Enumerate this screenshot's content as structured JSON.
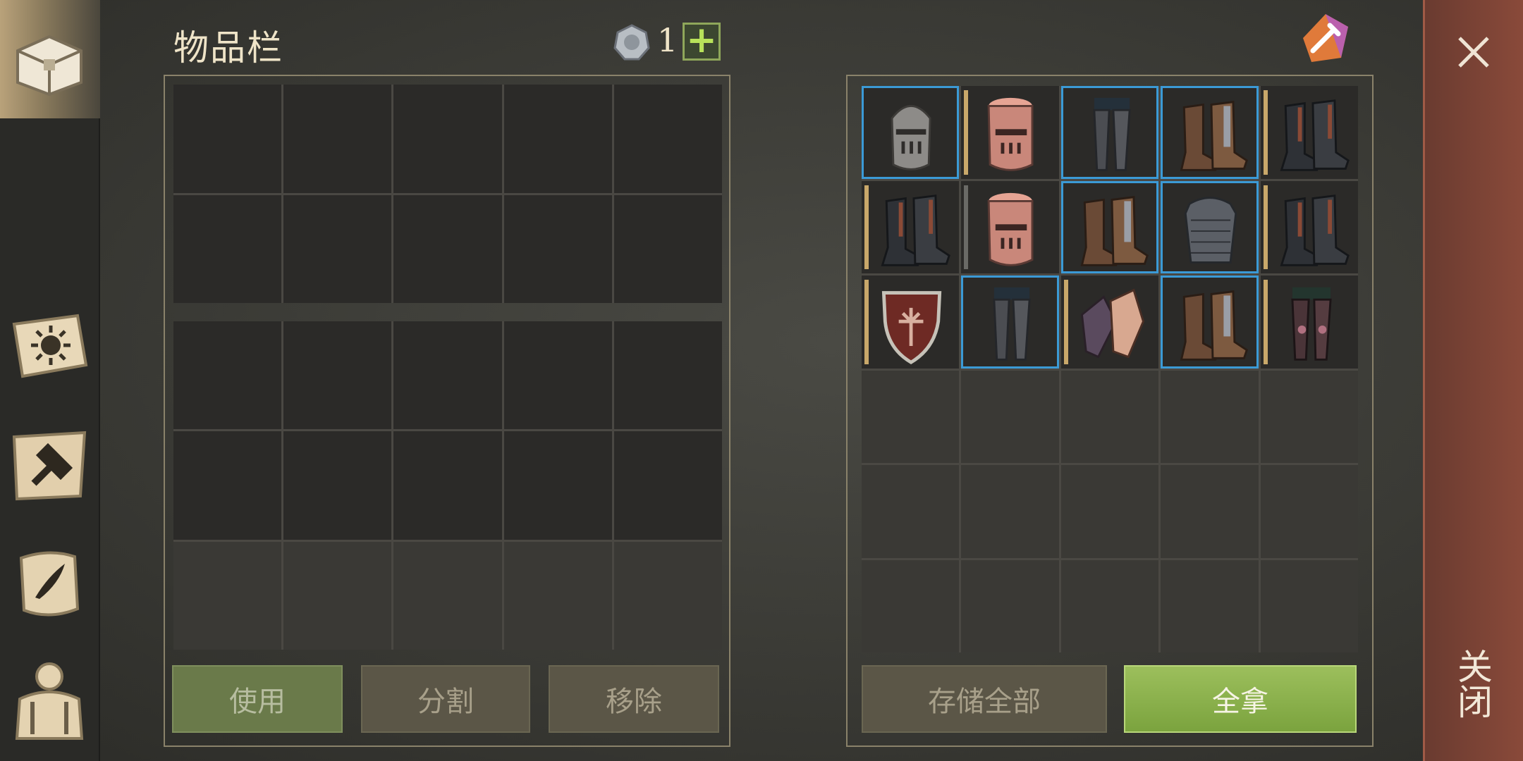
{
  "inventory": {
    "title": "物品栏",
    "coin_count": "1",
    "plus_label": "+"
  },
  "buttons": {
    "use": "使用",
    "split": "分割",
    "remove": "移除",
    "store_all": "存储全部",
    "take_all": "全拿"
  },
  "close": {
    "label": "关闭"
  },
  "colors": {
    "rarity_gold": "#c9a86a",
    "rarity_blue": "#3b9ad6",
    "accent_green": "#8fbf4a"
  },
  "container_items": [
    {
      "icon": "great-helm-icon",
      "rarity": "blue"
    },
    {
      "icon": "copper-great-helm-icon",
      "rarity": "gold"
    },
    {
      "icon": "chain-leggings-icon",
      "rarity": "blue"
    },
    {
      "icon": "leather-boots-icon",
      "rarity": "blue"
    },
    {
      "icon": "dark-boots-icon",
      "rarity": "gold"
    },
    {
      "icon": "dark-boots-icon",
      "rarity": "gold"
    },
    {
      "icon": "copper-great-helm-icon",
      "rarity": "gray"
    },
    {
      "icon": "leather-boots-icon",
      "rarity": "blue"
    },
    {
      "icon": "scale-armor-icon",
      "rarity": "blue"
    },
    {
      "icon": "dark-boots-icon",
      "rarity": "gold"
    },
    {
      "icon": "heater-shield-icon",
      "rarity": "gold"
    },
    {
      "icon": "chain-leggings-icon",
      "rarity": "blue"
    },
    {
      "icon": "gauntlets-icon",
      "rarity": "gold"
    },
    {
      "icon": "leather-boots-icon",
      "rarity": "blue"
    },
    {
      "icon": "red-leggings-icon",
      "rarity": "gold"
    }
  ]
}
